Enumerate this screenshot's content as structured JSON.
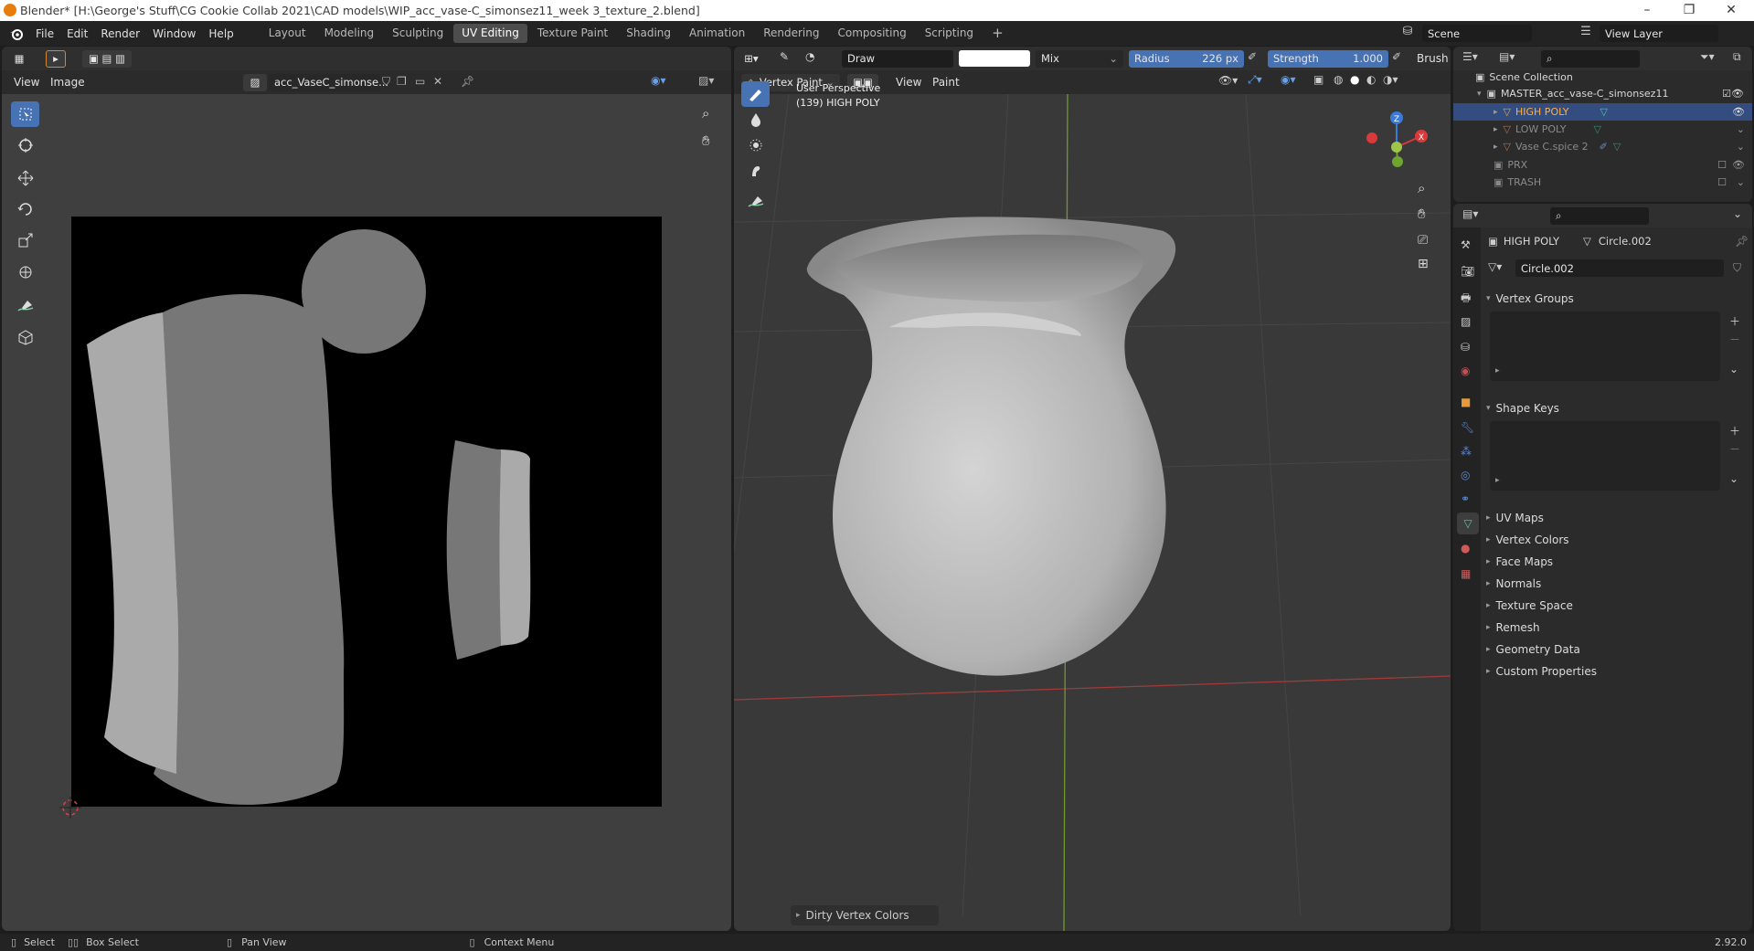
{
  "window": {
    "title": "Blender* [H:\\George's Stuff\\CG Cookie Collab 2021\\CAD models\\WIP_acc_vase-C_simonsez11_week 3_texture_2.blend]",
    "minimize": "–",
    "restore": "❐",
    "close": "✕"
  },
  "menus": [
    "File",
    "Edit",
    "Render",
    "Window",
    "Help"
  ],
  "workspaces": [
    "Layout",
    "Modeling",
    "Sculpting",
    "UV Editing",
    "Texture Paint",
    "Shading",
    "Animation",
    "Rendering",
    "Compositing",
    "Scripting"
  ],
  "active_workspace": "UV Editing",
  "add_workspace": "+",
  "scene": {
    "label": "Scene",
    "view_layer": "View Layer"
  },
  "uv_editor": {
    "menus": [
      "View",
      "Image"
    ],
    "image_name": "acc_VaseC_simonse..."
  },
  "viewport": {
    "brush_name": "Draw",
    "blend_mode": "Mix",
    "radius_label": "Radius",
    "radius_value": "226 px",
    "strength_label": "Strength",
    "strength_value": "1.000",
    "brush_menu": "Brush",
    "mode": "Vertex Paint",
    "menus": [
      "View",
      "Paint"
    ],
    "overlay_line1": "User Perspective",
    "overlay_line2": "(139) HIGH POLY",
    "operator_panel": "Dirty Vertex Colors",
    "axis_z": "Z",
    "axis_x": "X",
    "accent": "#4772b3"
  },
  "outliner": {
    "root": "Scene Collection",
    "items": [
      {
        "label": "MASTER_acc_vase-C_simonsez11",
        "selected": false
      },
      {
        "label": "HIGH POLY",
        "selected": true
      },
      {
        "label": "LOW POLY",
        "selected": false
      },
      {
        "label": "Vase C.spice 2",
        "selected": false
      },
      {
        "label": "PRX",
        "selected": false
      },
      {
        "label": "TRASH",
        "selected": false
      }
    ]
  },
  "properties": {
    "object_name": "HIGH POLY",
    "mesh_name": "Circle.002",
    "data_field": "Circle.002",
    "sections_open": [
      "Vertex Groups",
      "Shape Keys"
    ],
    "sections_closed": [
      "UV Maps",
      "Vertex Colors",
      "Face Maps",
      "Normals",
      "Texture Space",
      "Remesh",
      "Geometry Data",
      "Custom Properties"
    ]
  },
  "statusbar": {
    "items": [
      "Select",
      "Box Select",
      "Pan View",
      "Context Menu"
    ],
    "version": "2.92.0"
  }
}
